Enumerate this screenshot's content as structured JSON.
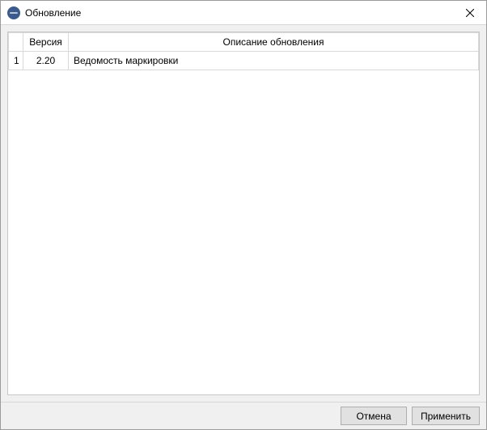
{
  "window": {
    "title": "Обновление"
  },
  "grid": {
    "headers": {
      "rownum": "",
      "version": "Версия",
      "description": "Описание обновления"
    },
    "rows": [
      {
        "num": "1",
        "version": "2.20",
        "description": "Ведомость маркировки"
      }
    ]
  },
  "footer": {
    "cancel": "Отмена",
    "apply": "Применить"
  }
}
